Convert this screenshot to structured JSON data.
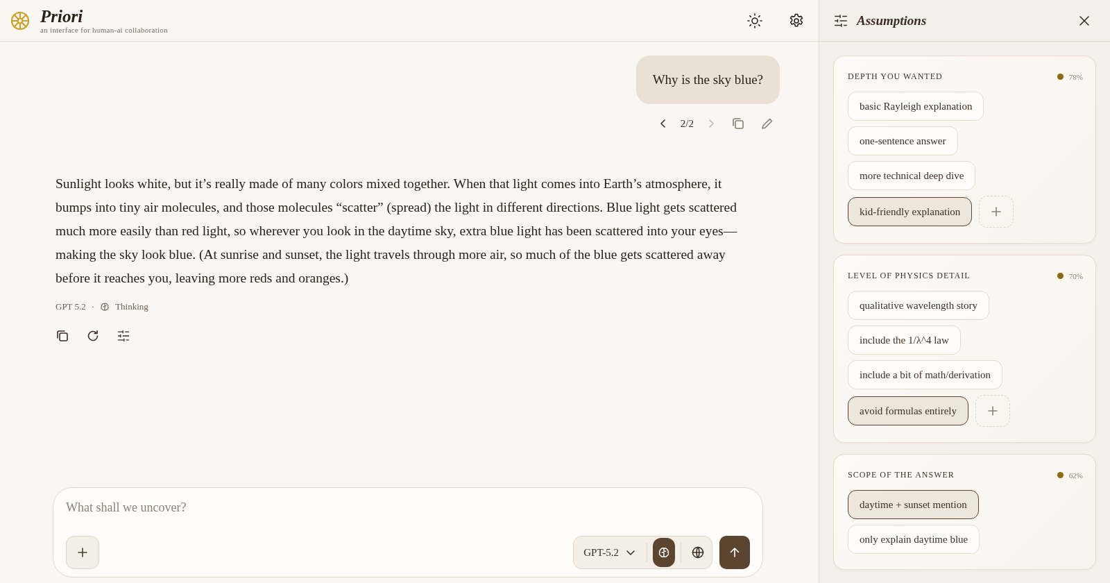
{
  "app": {
    "title": "Priori",
    "subtitle": "an interface for human-ai collaboration"
  },
  "user_message": {
    "text": "Why is the sky blue?",
    "pager": "2/2",
    "prev_enabled": true,
    "next_enabled": false
  },
  "assistant_message": {
    "text": "Sunlight looks white, but it’s really made of many colors mixed together. When that light comes into Earth’s atmosphere, it bumps into tiny air molecules, and those molecules “scatter” (spread) the light in different directions. Blue light gets scattered much more easily than red light, so wherever you look in the daytime sky, extra blue light has been scattered into your eyes—making the sky look blue. (At sunrise and sunset, the light travels through more air, so much of the blue gets scattered away before it reaches you, leaving more reds and oranges.)",
    "model": "GPT 5.2",
    "separator": "·",
    "mode": "Thinking"
  },
  "composer": {
    "placeholder": "What shall we uncover?",
    "model": "GPT-5.2",
    "thinking": true,
    "web_search": false
  },
  "sidebar": {
    "title": "Assumptions",
    "groups": [
      {
        "title": "DEPTH YOU WANTED",
        "confidence": "78%",
        "can_add": true,
        "options": [
          {
            "label": "basic Rayleigh explanation",
            "selected": false
          },
          {
            "label": "one-sentence answer",
            "selected": false
          },
          {
            "label": "more technical deep dive",
            "selected": false
          },
          {
            "label": "kid-friendly explanation",
            "selected": true
          }
        ]
      },
      {
        "title": "LEVEL OF PHYSICS DETAIL",
        "confidence": "70%",
        "can_add": true,
        "options": [
          {
            "label": "qualitative wavelength story",
            "selected": false
          },
          {
            "label": "include the 1/λ^4 law",
            "selected": false
          },
          {
            "label": "include a bit of math/derivation",
            "selected": false
          },
          {
            "label": "avoid formulas entirely",
            "selected": true
          }
        ]
      },
      {
        "title": "SCOPE OF THE ANSWER",
        "confidence": "62%",
        "can_add": false,
        "options": [
          {
            "label": "daytime + sunset mention",
            "selected": true
          },
          {
            "label": "only explain daytime blue",
            "selected": false
          }
        ]
      }
    ]
  }
}
